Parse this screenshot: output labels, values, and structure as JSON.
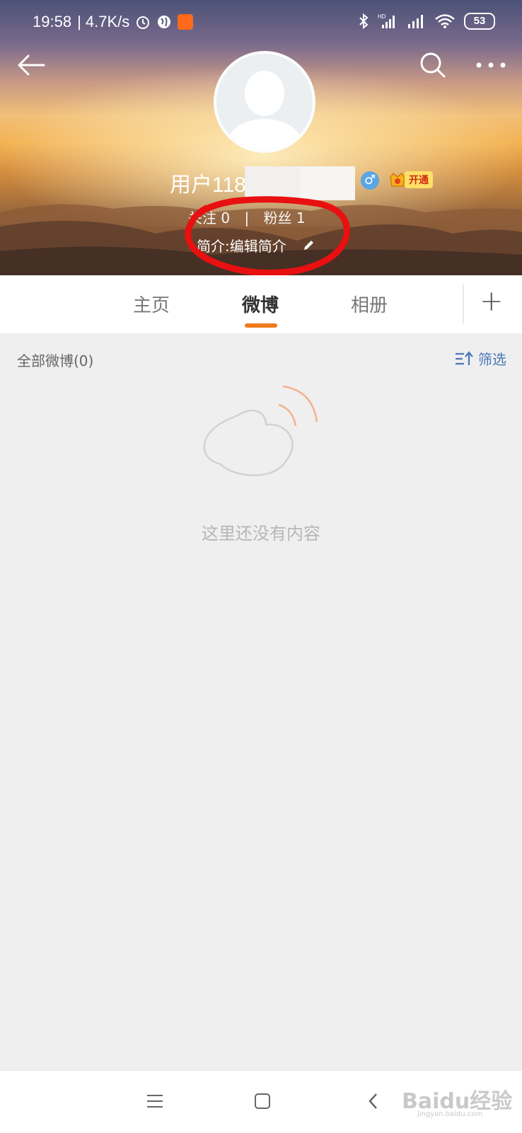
{
  "status_bar": {
    "time": "19:58",
    "speed": "| 4.7K/s",
    "battery": "53",
    "icons": [
      "alarm-icon",
      "network-globe-icon",
      "notification-app-icon",
      "bluetooth-icon",
      "signal-hd-icon",
      "signal-icon",
      "wifi-icon",
      "battery-icon"
    ]
  },
  "header": {
    "username": "用户118",
    "stats": {
      "following": "关注  0",
      "divider": "|",
      "fans": "粉丝  1"
    },
    "bio": "简介:编辑简介",
    "vip_label": "开通",
    "accent_colors": {
      "annotation_red": "#e81010",
      "orange": "#f07b1d"
    }
  },
  "tabs": {
    "items": [
      {
        "label": "主页"
      },
      {
        "label": "微博"
      },
      {
        "label": "相册"
      }
    ],
    "active": "微博",
    "add_label": "+"
  },
  "content": {
    "all_weibo": "全部微博(0)",
    "filter_label": "筛选",
    "empty_text": "这里还没有内容"
  },
  "watermark": {
    "text": "Baidu经验",
    "sub": "jingyan.baidu.com"
  }
}
